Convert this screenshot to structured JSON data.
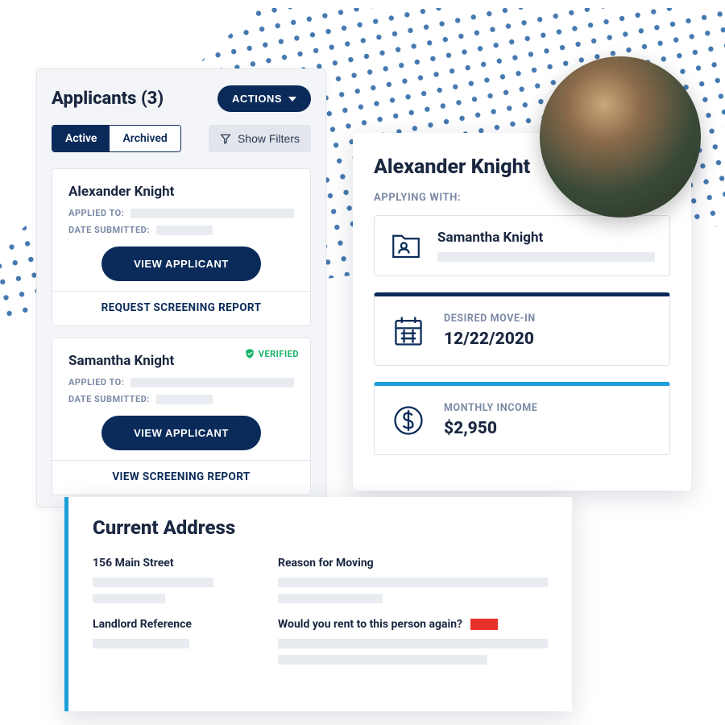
{
  "applicants": {
    "title": "Applicants",
    "count": "(3)",
    "actions_label": "ACTIONS",
    "tabs": {
      "active": "Active",
      "archived": "Archived"
    },
    "show_filters": "Show Filters",
    "cards": [
      {
        "name": "Alexander Knight",
        "applied_to_label": "APPLIED TO:",
        "date_submitted_label": "DATE SUBMITTED:",
        "view_label": "VIEW APPLICANT",
        "footer_action": "REQUEST SCREENING REPORT",
        "verified": false
      },
      {
        "name": "Samantha Knight",
        "applied_to_label": "APPLIED TO:",
        "date_submitted_label": "DATE SUBMITTED:",
        "view_label": "VIEW APPLICANT",
        "footer_action": "VIEW SCREENING REPORT",
        "verified": true,
        "verified_label": "VERIFIED"
      }
    ]
  },
  "detail": {
    "name": "Alexander Knight",
    "applying_with_label": "APPLYING WITH:",
    "with_name": "Samantha Knight",
    "move_in": {
      "label": "DESIRED MOVE-IN",
      "value": "12/22/2020"
    },
    "income": {
      "label": "MONTHLY INCOME",
      "value": "$2,950"
    }
  },
  "address": {
    "title": "Current Address",
    "street": "156 Main Street",
    "landlord_ref_label": "Landlord Reference",
    "reason_label": "Reason for Moving",
    "rent_again_label": "Would you rent to this person again?"
  },
  "colors": {
    "navy": "#0a2b5a",
    "blue": "#1b9ed9",
    "green": "#17b36a",
    "red": "#e9302a"
  }
}
